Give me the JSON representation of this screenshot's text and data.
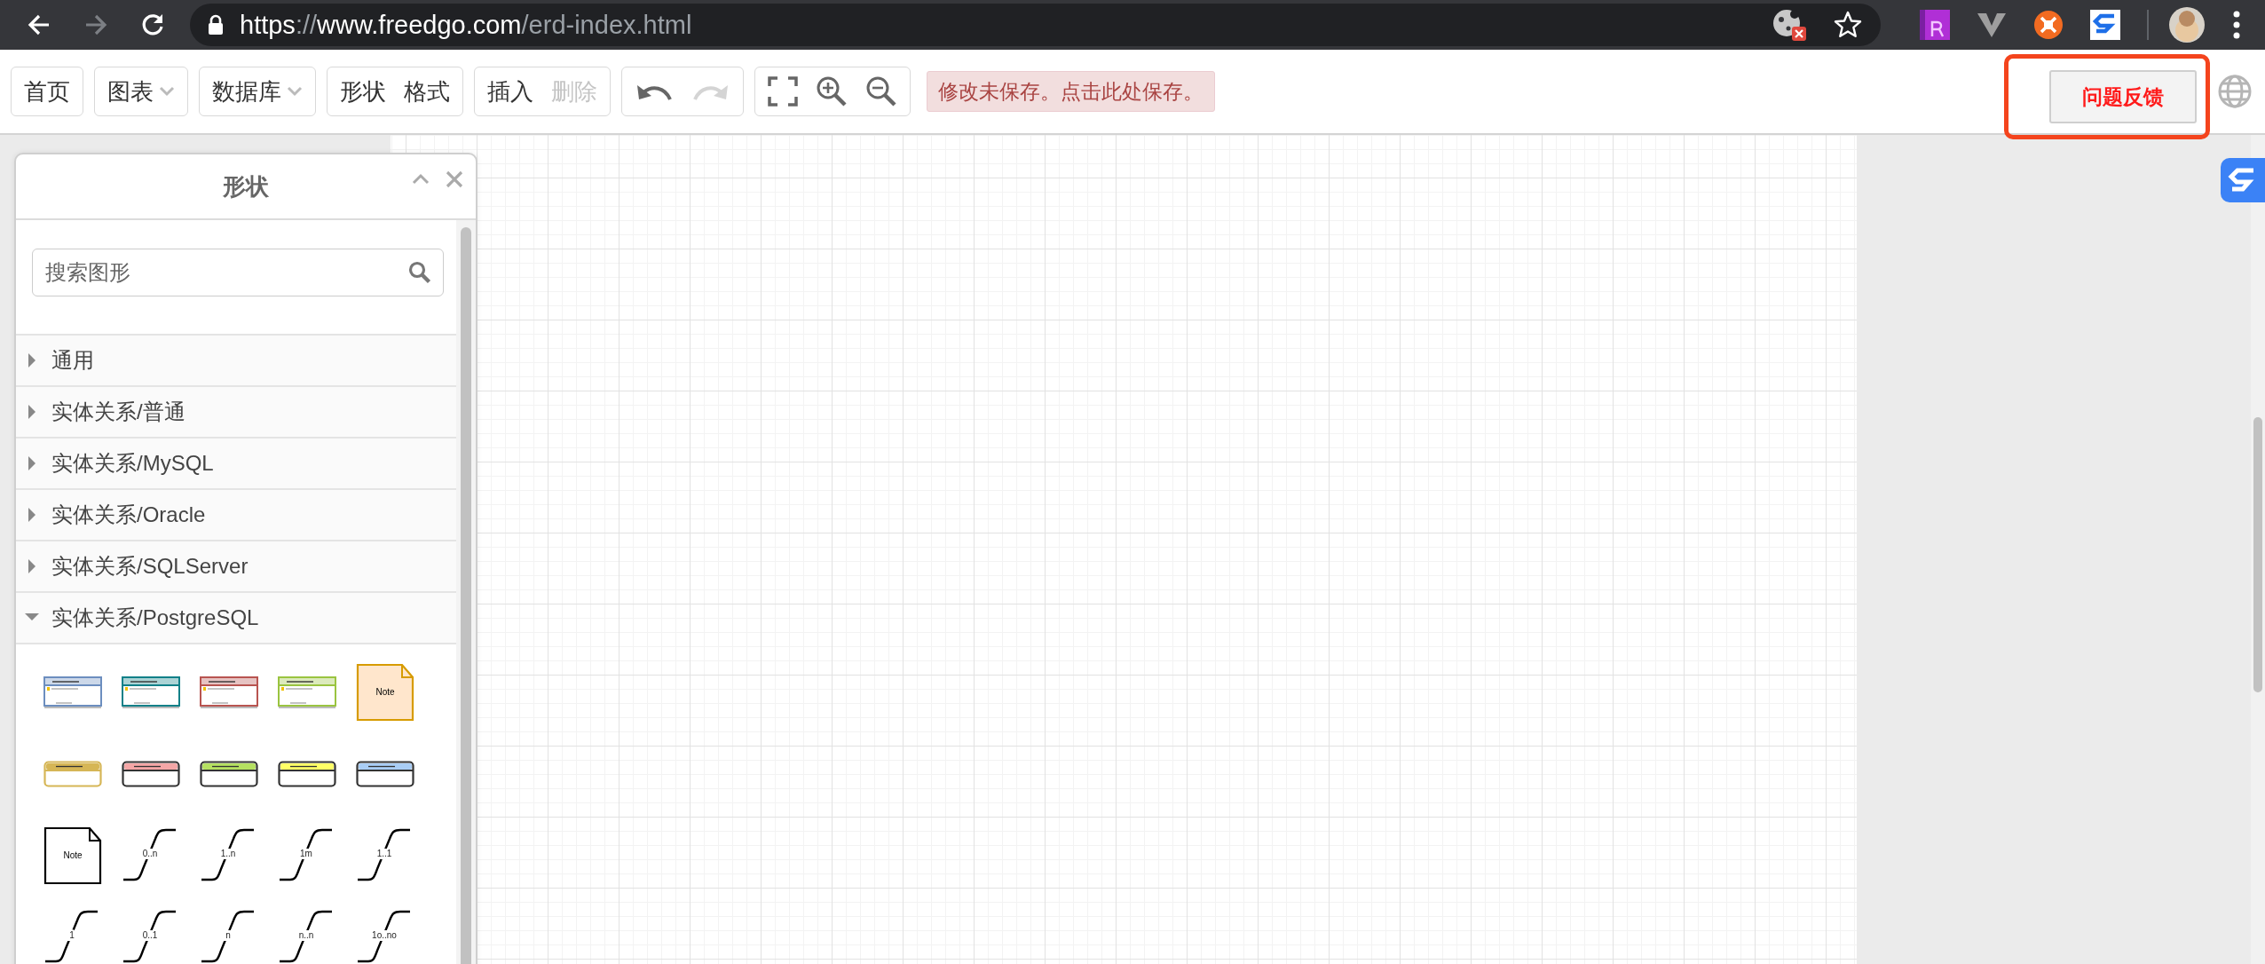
{
  "browser": {
    "forward_disabled": true,
    "url_parts": [
      {
        "text": "https",
        "dim": false
      },
      {
        "text": "://",
        "dim": true
      },
      {
        "text": "www.freedgo.com",
        "dim": false
      },
      {
        "text": "/erd-index.html",
        "dim": true
      }
    ]
  },
  "toolbar": {
    "groups": [
      {
        "items": [
          {
            "kind": "text",
            "label": "首页",
            "dropdown": false,
            "disabled": false
          }
        ]
      },
      {
        "items": [
          {
            "kind": "text",
            "label": "图表",
            "dropdown": true,
            "disabled": false
          }
        ]
      },
      {
        "items": [
          {
            "kind": "text",
            "label": "数据库",
            "dropdown": true,
            "disabled": false
          }
        ]
      },
      {
        "items": [
          {
            "kind": "text",
            "label": "形状",
            "dropdown": false,
            "disabled": false
          },
          {
            "kind": "text",
            "label": "格式",
            "dropdown": false,
            "disabled": false
          }
        ]
      },
      {
        "items": [
          {
            "kind": "text",
            "label": "插入",
            "dropdown": false,
            "disabled": false
          },
          {
            "kind": "text",
            "label": "删除",
            "dropdown": false,
            "disabled": true
          }
        ]
      },
      {
        "items": [
          {
            "kind": "undo",
            "disabled": false
          },
          {
            "kind": "redo",
            "disabled": true
          }
        ]
      },
      {
        "items": [
          {
            "kind": "fit",
            "disabled": false
          },
          {
            "kind": "zoom-in",
            "disabled": false
          },
          {
            "kind": "zoom-out",
            "disabled": false
          }
        ]
      }
    ],
    "notice": "修改未保存。点击此处保存。",
    "feedback": {
      "label": "问题反馈",
      "highlighted": true
    }
  },
  "shapes_panel": {
    "title": "形状",
    "search": {
      "placeholder": "搜索图形"
    },
    "categories": [
      {
        "label": "通用",
        "expanded": false
      },
      {
        "label": "实体关系/普通",
        "expanded": false
      },
      {
        "label": "实体关系/MySQL",
        "expanded": false
      },
      {
        "label": "实体关系/Oracle",
        "expanded": false
      },
      {
        "label": "实体关系/SQLServer",
        "expanded": false
      },
      {
        "label": "实体关系/PostgreSQL",
        "expanded": true
      }
    ],
    "shapes": [
      {
        "kind": "table",
        "color": "#6c8ebf"
      },
      {
        "kind": "table",
        "color": "#0e8088"
      },
      {
        "kind": "table",
        "color": "#b85450"
      },
      {
        "kind": "table",
        "color": "#9ac440"
      },
      {
        "kind": "note",
        "color": "#d79b00",
        "label": "Note"
      },
      {
        "kind": "object",
        "color": "#d6b656"
      },
      {
        "kind": "object",
        "color": "#f4a6a6"
      },
      {
        "kind": "object",
        "color": "#b5e061"
      },
      {
        "kind": "object",
        "color": "#ffff66"
      },
      {
        "kind": "object",
        "color": "#a9cdf5"
      },
      {
        "kind": "note",
        "color": "#000000",
        "label": "Note"
      },
      {
        "kind": "relation",
        "label": "0..n"
      },
      {
        "kind": "relation",
        "label": "1..n"
      },
      {
        "kind": "relation",
        "label": "1m"
      },
      {
        "kind": "relation",
        "label": "1..1"
      },
      {
        "kind": "relation",
        "label": "1"
      },
      {
        "kind": "relation",
        "label": "0..1"
      },
      {
        "kind": "relation",
        "label": "n"
      },
      {
        "kind": "relation",
        "label": "n..n"
      },
      {
        "kind": "relation",
        "label": "1o..no"
      }
    ]
  }
}
